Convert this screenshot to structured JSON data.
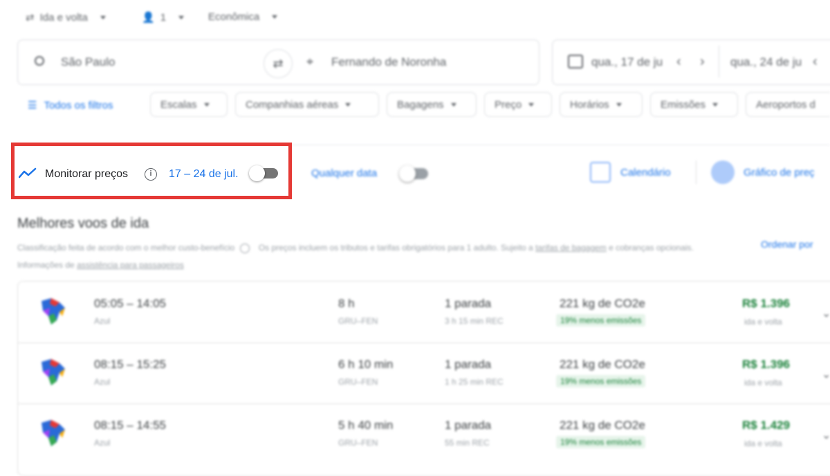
{
  "top_options": {
    "trip_type": "Ida e volta",
    "passengers": "1",
    "cabin": "Econômica"
  },
  "search": {
    "origin": "São Paulo",
    "destination": "Fernando de Noronha",
    "depart_date": "qua., 17 de ju",
    "return_date": "qua., 24 de ju"
  },
  "filters": {
    "all_filters": "Todos os filtros",
    "chips": [
      "Escalas",
      "Companhias aéreas",
      "Bagagens",
      "Preço",
      "Horários",
      "Emissões",
      "Aeroportos d"
    ]
  },
  "monitor": {
    "label": "Monitorar preços",
    "date_range": "17 – 24 de jul.",
    "any_date": "Qualquer data",
    "calendar": "Calendário",
    "price_graph": "Gráfico de preç"
  },
  "results": {
    "heading": "Melhores voos de ida",
    "subtitle_line1": "Classificação feita de acordo com o melhor custo-benefício",
    "subtitle_line1b": "Os preços incluem os tributos e tarifas obrigatórios para 1 adulto. Sujeito a",
    "subtitle_link1": "tarifas de bagagem",
    "subtitle_line2": "e cobranças opcionais. Informações de",
    "subtitle_link2": "assistência para passageiros",
    "sort": "Ordenar por"
  },
  "flights": [
    {
      "times": "05:05 – 14:05",
      "airline": "Azul",
      "duration": "8 h",
      "route": "GRU–FEN",
      "stops": "1 parada",
      "stop_detail": "3 h 15 min REC",
      "co2": "221 kg de CO2e",
      "emissions": "19% menos emissões",
      "price": "R$ 1.396",
      "price_note": "ida e volta"
    },
    {
      "times": "08:15 – 15:25",
      "airline": "Azul",
      "duration": "6 h 10 min",
      "route": "GRU–FEN",
      "stops": "1 parada",
      "stop_detail": "1 h 25 min REC",
      "co2": "221 kg de CO2e",
      "emissions": "19% menos emissões",
      "price": "R$ 1.396",
      "price_note": "ida e volta"
    },
    {
      "times": "08:15 – 14:55",
      "airline": "Azul",
      "duration": "5 h 40 min",
      "route": "GRU–FEN",
      "stops": "1 parada",
      "stop_detail": "55 min REC",
      "co2": "221 kg de CO2e",
      "emissions": "19% menos emissões",
      "price": "R$ 1.429",
      "price_note": "ida e volta"
    }
  ],
  "colors": {
    "accent": "#1a73e8",
    "highlight": "#e53935",
    "price_green": "#188038"
  }
}
